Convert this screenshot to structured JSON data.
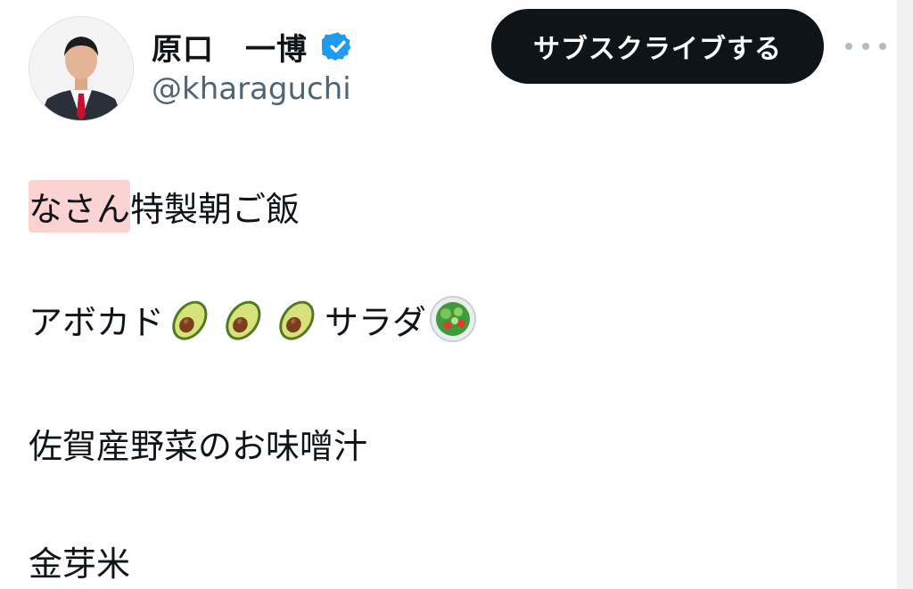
{
  "profile": {
    "display_name": "原口　一博",
    "handle": "@kharaguchi"
  },
  "header": {
    "subscribe_label": "サブスクライブする"
  },
  "tweet": {
    "line1_highlight": "なさん",
    "line1_rest": "特製朝ご飯",
    "line2_before": "アボカド",
    "line2_emojis": [
      "avocado",
      "avocado",
      "avocado"
    ],
    "line2_after": "サラダ",
    "line2_end_emoji": "green-salad",
    "line3": "佐賀産野菜のお味噌汁",
    "line4": "金芽米"
  },
  "colors": {
    "subscribe_bg": "#0f1419",
    "verified": "#1d9bf0",
    "handle": "#536471",
    "highlight": "#fcd3d3"
  }
}
